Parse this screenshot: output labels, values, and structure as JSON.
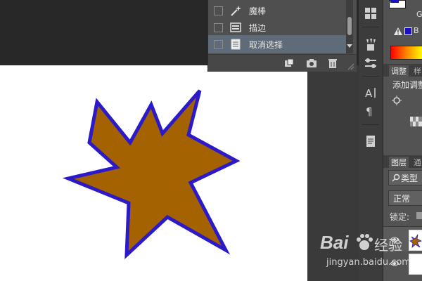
{
  "history": {
    "items": [
      {
        "label": "魔棒",
        "icon": "magic-wand-icon",
        "selected": false
      },
      {
        "label": "描边",
        "icon": "stroke-icon",
        "selected": false
      },
      {
        "label": "取消选择",
        "icon": "document-icon",
        "selected": true
      }
    ],
    "footer_icons": [
      "new-document-from-state-icon",
      "camera-snapshot-icon",
      "trash-icon"
    ]
  },
  "dock": {
    "adjust_tabs": [
      "调整",
      "样"
    ],
    "add_adjustment": "添加调整",
    "layers_tabs": [
      "图层",
      "通"
    ],
    "search_kind": "类型",
    "blend_mode": "正常",
    "lock_label": "锁定:",
    "g_label": "G",
    "b_label": "B"
  },
  "watermark": {
    "brand_main": "Bai",
    "brand_tail": "经验",
    "url": "jingyan.baidu.com"
  },
  "colors": {
    "star_fill": "#a46300",
    "star_stroke": "#2c1ac8",
    "selected_row": "#5f6b78",
    "foreground_swatch": "#1b0fc4"
  }
}
